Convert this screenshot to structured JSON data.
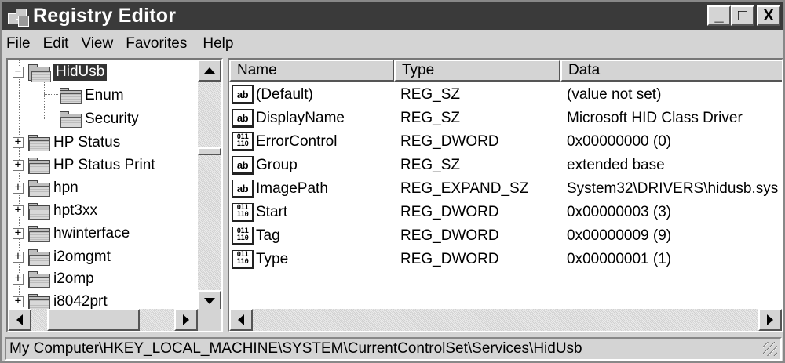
{
  "window": {
    "title": "Registry Editor",
    "buttons": [
      "_",
      "□",
      "X"
    ]
  },
  "menubar": [
    "File",
    "Edit",
    "View",
    "Favorites",
    "Help"
  ],
  "tree": {
    "items": [
      {
        "label": "HidUsb",
        "expander": "−",
        "selected": true,
        "icon": "open-folder-icon"
      },
      {
        "label": "Enum",
        "expander": "",
        "icon": "folder-icon"
      },
      {
        "label": "Security",
        "expander": "",
        "icon": "folder-icon"
      },
      {
        "label": "HP Status",
        "expander": "+",
        "icon": "folder-icon"
      },
      {
        "label": "HP Status Print",
        "expander": "+",
        "icon": "folder-icon"
      },
      {
        "label": "hpn",
        "expander": "+",
        "icon": "folder-icon"
      },
      {
        "label": "hpt3xx",
        "expander": "+",
        "icon": "folder-icon"
      },
      {
        "label": "hwinterface",
        "expander": "+",
        "icon": "folder-icon"
      },
      {
        "label": "i2omgmt",
        "expander": "+",
        "icon": "folder-icon"
      },
      {
        "label": "i2omp",
        "expander": "+",
        "icon": "folder-icon"
      },
      {
        "label": "i8042prt",
        "expander": "+",
        "icon": "folder-icon"
      }
    ]
  },
  "list": {
    "columns": [
      "Name",
      "Type",
      "Data"
    ],
    "rows": [
      {
        "name": "(Default)",
        "type": "REG_SZ",
        "data": "(value not set)",
        "icon": "string-value-icon"
      },
      {
        "name": "DisplayName",
        "type": "REG_SZ",
        "data": "Microsoft HID Class Driver",
        "icon": "string-value-icon"
      },
      {
        "name": "ErrorControl",
        "type": "REG_DWORD",
        "data": "0x00000000 (0)",
        "icon": "binary-value-icon"
      },
      {
        "name": "Group",
        "type": "REG_SZ",
        "data": "extended base",
        "icon": "string-value-icon"
      },
      {
        "name": "ImagePath",
        "type": "REG_EXPAND_SZ",
        "data": "System32\\DRIVERS\\hidusb.sys",
        "icon": "string-value-icon"
      },
      {
        "name": "Start",
        "type": "REG_DWORD",
        "data": "0x00000003 (3)",
        "icon": "binary-value-icon"
      },
      {
        "name": "Tag",
        "type": "REG_DWORD",
        "data": "0x00000009 (9)",
        "icon": "binary-value-icon"
      },
      {
        "name": "Type",
        "type": "REG_DWORD",
        "data": "0x00000001 (1)",
        "icon": "binary-value-icon"
      }
    ]
  },
  "icon_text": {
    "string": "ab",
    "binary_top": "011",
    "binary_bottom": "110"
  },
  "statusbar": {
    "path": "My Computer\\HKEY_LOCAL_MACHINE\\SYSTEM\\CurrentControlSet\\Services\\HidUsb"
  }
}
